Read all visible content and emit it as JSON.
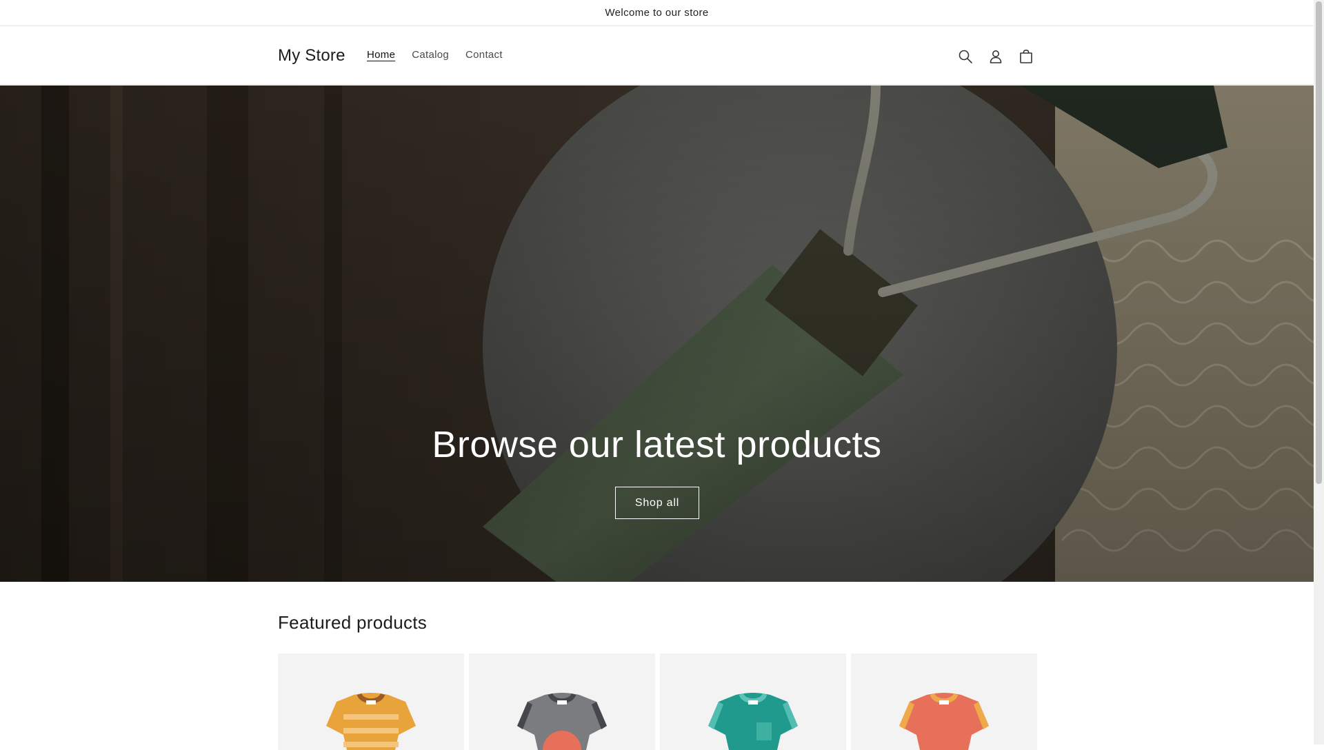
{
  "announcement": {
    "text": "Welcome to our store"
  },
  "header": {
    "logo": "My Store",
    "nav": [
      {
        "label": "Home",
        "active": true
      },
      {
        "label": "Catalog",
        "active": false
      },
      {
        "label": "Contact",
        "active": false
      }
    ],
    "icons": [
      "search-icon",
      "account-icon",
      "cart-icon"
    ]
  },
  "hero": {
    "heading": "Browse our latest products",
    "button_label": "Shop all"
  },
  "featured": {
    "title": "Featured products",
    "products": [
      {
        "icon": "striped-tshirt-icon",
        "color": "#E8A33B"
      },
      {
        "icon": "gray-tshirt-icon",
        "color": "#7A7C80"
      },
      {
        "icon": "teal-tshirt-icon",
        "color": "#1F9A8D"
      },
      {
        "icon": "coral-tshirt-icon",
        "color": "#E7705A"
      }
    ]
  }
}
